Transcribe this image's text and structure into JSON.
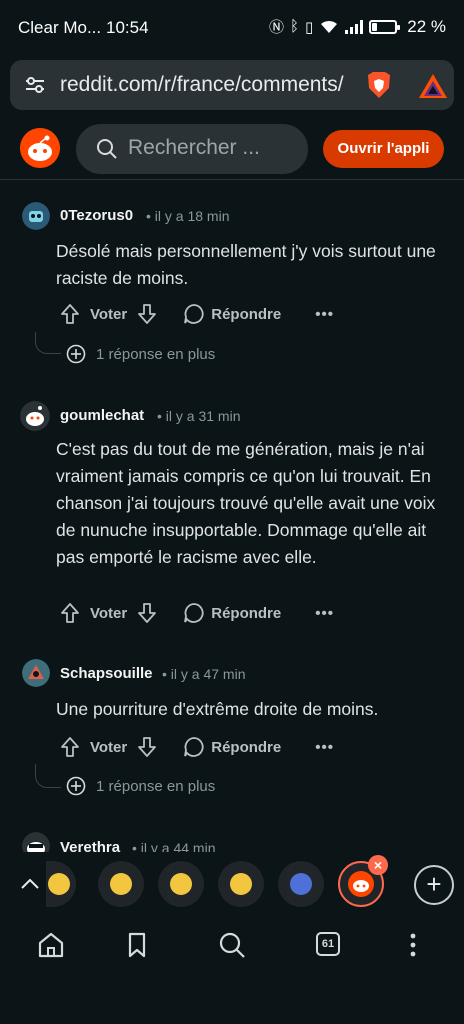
{
  "status_bar": {
    "carrier": "Clear Mo...",
    "time": "10:54",
    "battery_percent": "22 %",
    "battery_level": 0.22
  },
  "browser": {
    "url": "reddit.com/r/france/comments/",
    "icons": [
      "tune-icon",
      "brave-shield-icon",
      "brave-rewards-icon"
    ]
  },
  "reddit_header": {
    "search_placeholder": "Rechercher ...",
    "open_app_label": "Ouvrir l'appli",
    "brand_color": "#ff4500",
    "accent_color": "#d93a00"
  },
  "comments": [
    {
      "username": "0Tezorus0",
      "time": "• il y a 18 min",
      "body": "Désolé mais personnellement j'y vois surtout une raciste de moins.",
      "vote_label": "Voter",
      "reply_label": "Répondre",
      "more_replies": "1 réponse en plus"
    },
    {
      "username": "goumlechat",
      "time": "• il y a 31 min",
      "body": "C'est pas du tout de me génération, mais je n'ai vraiment jamais compris ce qu'on lui trouvait. En chanson j'ai toujours trouvé qu'elle avait une voix de nunuche insupportable. Dommage qu'elle ait pas emporté le racisme avec elle.",
      "vote_label": "Voter",
      "reply_label": "Répondre"
    },
    {
      "username": "Schapsouille",
      "time": "• il y a 47 min",
      "body": "Une pourriture d'extrême droite de moins.",
      "vote_label": "Voter",
      "reply_label": "Répondre",
      "more_replies": "1 réponse en plus"
    },
    {
      "username": "Verethra",
      "time": "• il y a 44 min"
    }
  ],
  "tab_strip": {
    "tab_count": "61",
    "close_symbol": "×",
    "new_tab_symbol": "+"
  },
  "bottom_nav": [
    "home-icon",
    "bookmark-icon",
    "search-icon",
    "tabs-icon",
    "menu-icon"
  ]
}
